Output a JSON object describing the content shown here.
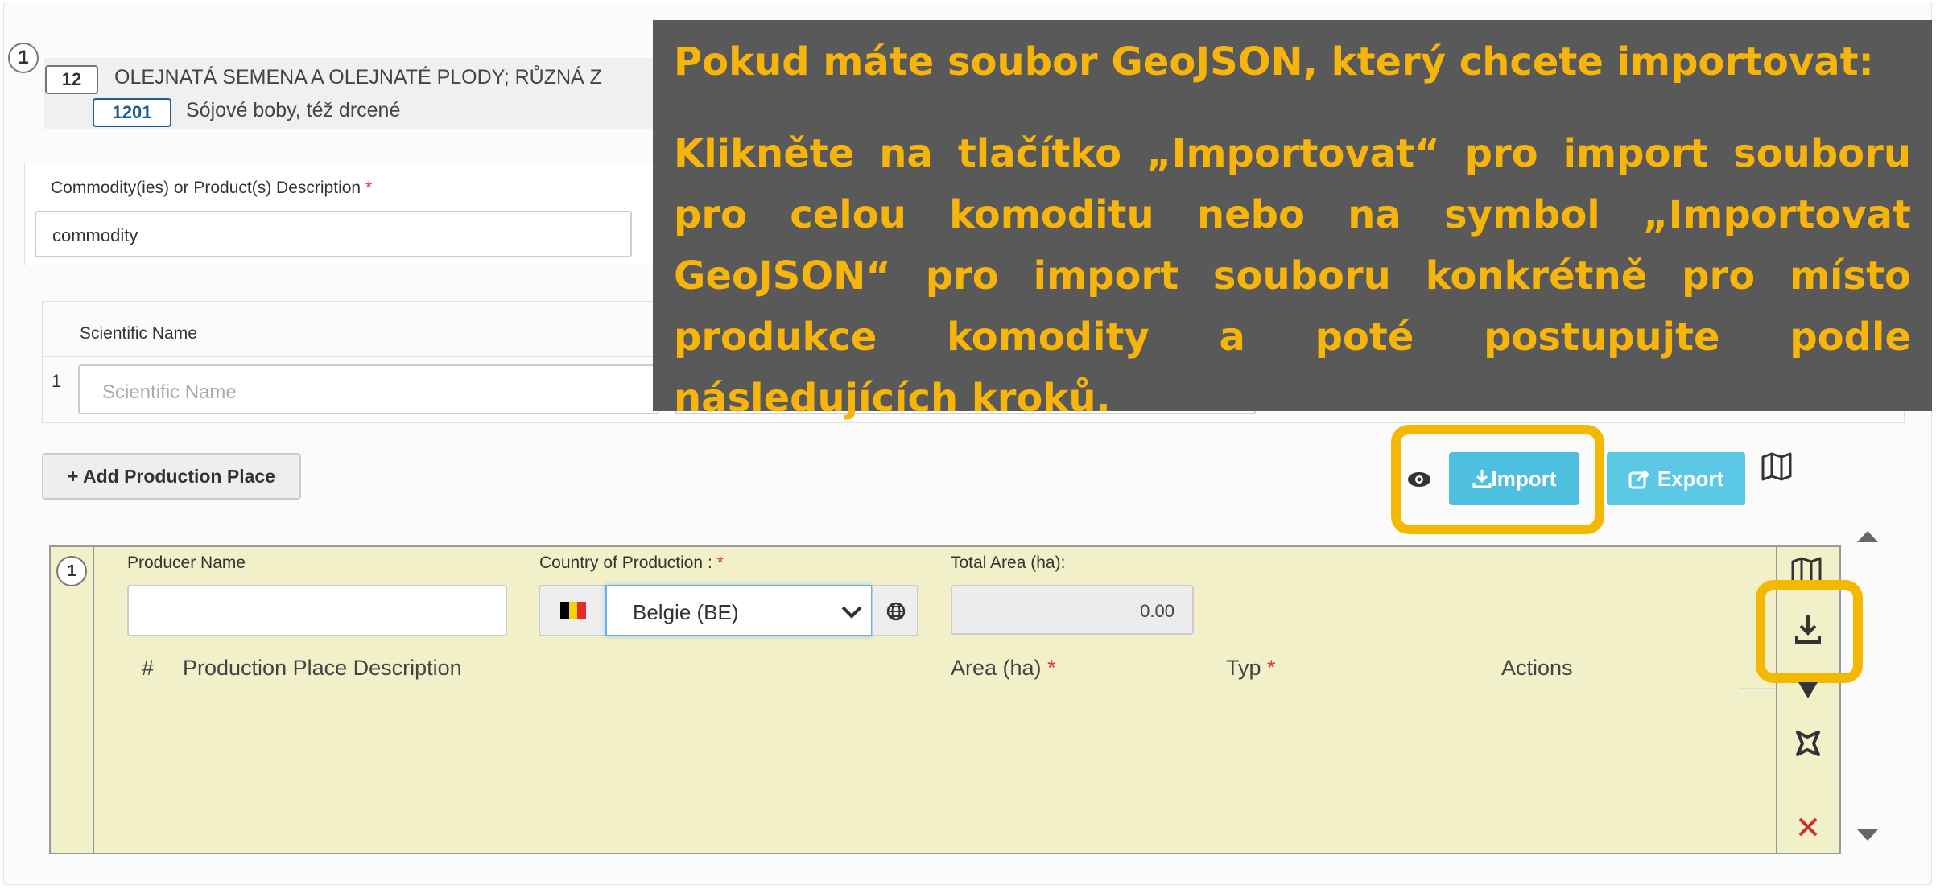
{
  "commodity": {
    "index": "1",
    "code": "12",
    "title": "OLEJNATÁ SEMENA A OLEJNATÉ PLODY; RŮZNÁ Z",
    "subcode": "1201",
    "subtitle": "Sójové boby, též drcené",
    "description_label": "Commodity(ies) or Product(s) Description",
    "required_mark": "*",
    "description_value": "commodity"
  },
  "scientific": {
    "header": "Scientific Name",
    "row_index": "1",
    "placeholder": "Scientific Name"
  },
  "toolbar": {
    "add_label": "+ Add Production Place",
    "import_label": "Import",
    "export_label": "Export"
  },
  "production_place": {
    "index": "1",
    "producer_label": "Producer Name",
    "producer_value": "",
    "country_label": "Country of Production :",
    "required_mark": "*",
    "country_value": "Belgie (BE)",
    "area_total_label": "Total Area (ha):",
    "area_total_value": "0.00",
    "columns": {
      "hash": "#",
      "description": "Production Place Description",
      "area": "Area (ha)",
      "type": "Typ",
      "actions": "Actions"
    }
  },
  "overlay": {
    "heading": "Pokud máte soubor GeoJSON, který chcete importovat:",
    "body": "Klikněte na tlačítko „Importovat“ pro import souboru pro celou komoditu nebo na symbol „Importovat GeoJSON“ pro import souboru konkrétně pro místo produkce komodity a poté postupujte podle následujících kroků."
  },
  "icons": {
    "eye": "eye-icon",
    "download": "download-icon",
    "share": "share-icon",
    "map": "map-icon",
    "globe": "globe-icon",
    "polygon": "polygon-icon",
    "close": "close-icon",
    "flag": "belgium-flag-icon"
  },
  "colors": {
    "highlight": "#f5b800",
    "overlay_bg": "#595959",
    "overlay_text": "#f7b50c",
    "info_button": "#4fbfdf",
    "row_bg": "#f2f0c8"
  }
}
